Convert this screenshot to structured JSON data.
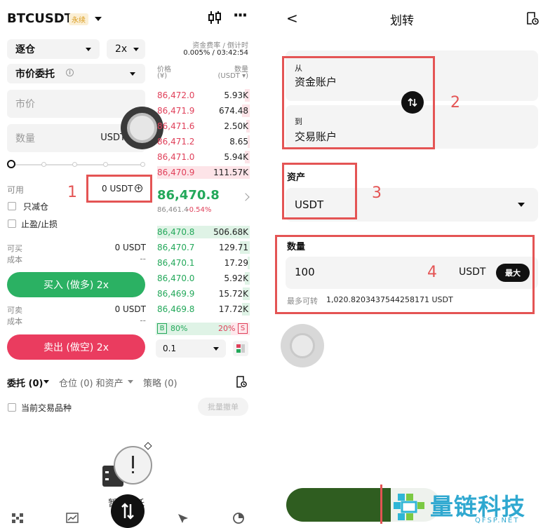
{
  "left": {
    "header": {
      "symbol": "BTCUSDT",
      "badge": "永续",
      "more": "···"
    },
    "margin_mode": "逐仓",
    "leverage": "2x",
    "funding": {
      "label": "资金费率 / 倒计时",
      "value": "0.005% / 03:42:54"
    },
    "order_type": "市价委托",
    "price_input": "市价",
    "qty_input": "数量",
    "qty_unit": "USDT",
    "available_label": "可用",
    "available_value": "0 USDT",
    "reduce_only": "只减仓",
    "tpsl": "止盈/止损",
    "buy_block": {
      "can_buy_label": "可买",
      "can_buy_value": "0 USDT",
      "cost_label": "成本",
      "cost_value": "--",
      "button": "买入 (做多) 2x"
    },
    "sell_block": {
      "can_sell_label": "可卖",
      "can_sell_value": "0 USDT",
      "cost_label": "成本",
      "cost_value": "--",
      "button": "卖出 (做空) 2x"
    },
    "orderbook": {
      "price_header": "价格",
      "price_unit": "(¥)",
      "qty_header": "数量",
      "qty_unit": "(USDT ▾)",
      "asks": [
        {
          "price": "86,472.0",
          "qty": "5.93K"
        },
        {
          "price": "86,471.9",
          "qty": "674.48"
        },
        {
          "price": "86,471.6",
          "qty": "2.50K"
        },
        {
          "price": "86,471.2",
          "qty": "8.65"
        },
        {
          "price": "86,471.0",
          "qty": "5.94K"
        },
        {
          "price": "86,470.9",
          "qty": "111.57K"
        }
      ],
      "last_price": "86,470.8",
      "mark_price": "86,461.4",
      "change": "-0.54%",
      "bids": [
        {
          "price": "86,470.8",
          "qty": "506.68K"
        },
        {
          "price": "86,470.7",
          "qty": "129.71"
        },
        {
          "price": "86,470.1",
          "qty": "17.29"
        },
        {
          "price": "86,470.0",
          "qty": "5.92K"
        },
        {
          "price": "86,469.9",
          "qty": "15.72K"
        },
        {
          "price": "86,469.8",
          "qty": "17.72K"
        }
      ],
      "buy_ratio_tag": "B",
      "buy_ratio": "80%",
      "sell_ratio": "20%",
      "sell_ratio_tag": "S",
      "buy_ratio_value": 0.8,
      "depth": "0.1"
    },
    "tabs": {
      "orders": "委托 (0)",
      "positions": "仓位 (0) 和资产",
      "strategies": "策略 (0)"
    },
    "current_symbol_only": "当前交易品种",
    "batch_cancel": "批量撤单",
    "empty_text": "暂无委托",
    "annotation": "1"
  },
  "right": {
    "back": "<",
    "title": "划转",
    "from_label": "从",
    "from_account": "资金账户",
    "to_label": "到",
    "to_account": "交易账户",
    "asset_label": "资产",
    "asset_value": "USDT",
    "qty_label": "数量",
    "qty_value": "100",
    "qty_unit": "USDT",
    "max_button": "最大",
    "max_transfer_label": "最多可转",
    "max_transfer_value": "1,020.8203437544258171 USDT",
    "annotations": [
      "2",
      "3",
      "4"
    ],
    "watermark": {
      "name": "量链科技",
      "site": "QFSP.NET"
    }
  },
  "colors": {
    "green": "#23a85a",
    "red": "#e0405a",
    "annotation_red": "#e45454"
  }
}
